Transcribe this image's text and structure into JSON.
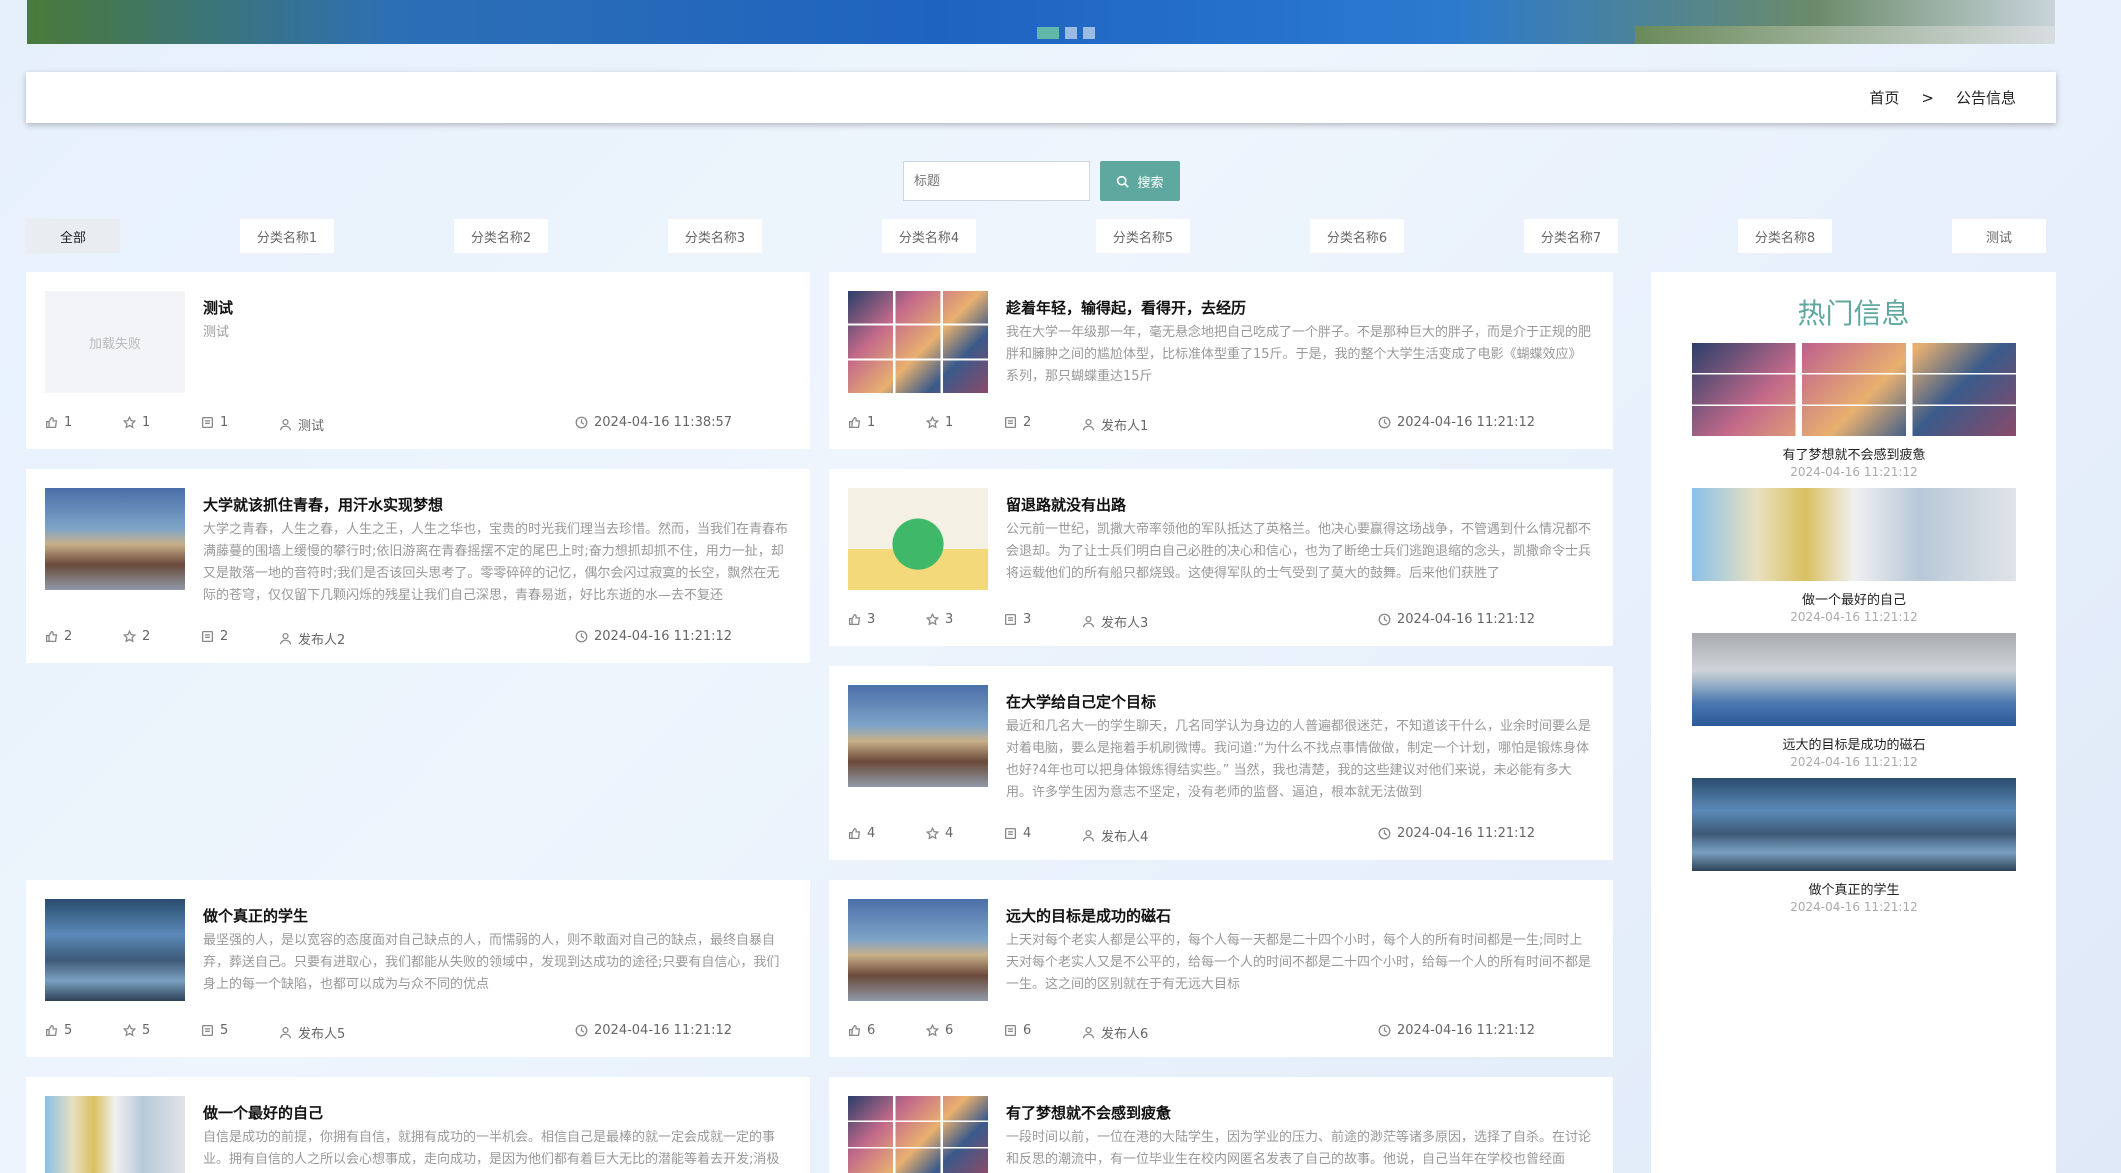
{
  "breadcrumb": {
    "home": "首页",
    "separator": ">",
    "current": "公告信息"
  },
  "search": {
    "placeholder": "标题",
    "button_label": "搜索"
  },
  "categories": [
    "全部",
    "分类名称1",
    "分类名称2",
    "分类名称3",
    "分类名称4",
    "分类名称5",
    "分类名称6",
    "分类名称7",
    "分类名称8",
    "测试"
  ],
  "placeholder_text": "加载失败",
  "articles": [
    {
      "title": "测试",
      "desc": "测试",
      "likes": "1",
      "favorites": "1",
      "comments": "1",
      "author": "测试",
      "time": "2024-04-16 11:38:57"
    },
    {
      "title": "趁着年轻，输得起，看得开，去经历",
      "desc": "我在大学一年级那一年，毫无悬念地把自己吃成了一个胖子。不是那种巨大的胖子，而是介于正规的肥胖和臃肿之间的尴尬体型，比标准体型重了15斤。于是，我的整个大学生活变成了电影《蝴蝶效应》系列，那只蝴蝶重达15斤",
      "likes": "1",
      "favorites": "1",
      "comments": "2",
      "author": "发布人1",
      "time": "2024-04-16 11:21:12"
    },
    {
      "title": "大学就该抓住青春，用汗水实现梦想",
      "desc": "大学之青春，人生之春，人生之王，人生之华也，宝贵的时光我们理当去珍惜。然而，当我们在青春布满藤蔓的围墙上缓慢的攀行时;依旧游离在青春摇摆不定的尾巴上时;奋力想抓却抓不住，用力一扯，却又是散落一地的音符时;我们是否该回头思考了。零零碎碎的记忆，偶尔会闪过寂寞的长空，飘然在无际的苍穹，仅仅留下几颗闪烁的残星让我们自己深思，青春易逝，好比东逝的水—去不复还",
      "likes": "2",
      "favorites": "2",
      "comments": "2",
      "author": "发布人2",
      "time": "2024-04-16 11:21:12"
    },
    {
      "title": "留退路就没有出路",
      "desc": "公元前一世纪，凯撒大帝率领他的军队抵达了英格兰。他决心要赢得这场战争，不管遇到什么情况都不会退却。为了让士兵们明白自己必胜的决心和信心，也为了断绝士兵们逃跑退缩的念头，凯撒命令士兵将运载他们的所有船只都烧毁。这使得军队的士气受到了莫大的鼓舞。后来他们获胜了",
      "likes": "3",
      "favorites": "3",
      "comments": "3",
      "author": "发布人3",
      "time": "2024-04-16 11:21:12"
    },
    {
      "title": "在大学给自己定个目标",
      "desc": "最近和几名大一的学生聊天，几名同学认为身边的人普遍都很迷茫，不知道该干什么，业余时间要么是对着电脑，要么是拖着手机刷微博。我问道:“为什么不找点事情做做，制定一个计划，哪怕是锻炼身体也好?4年也可以把身体锻炼得结实些。” 当然，我也清楚，我的这些建议对他们来说，未必能有多大用。许多学生因为意志不坚定，没有老师的监督、逼迫，根本就无法做到",
      "likes": "4",
      "favorites": "4",
      "comments": "4",
      "author": "发布人4",
      "time": "2024-04-16 11:21:12"
    },
    {
      "title": "做个真正的学生",
      "desc": "最坚强的人，是以宽容的态度面对自己缺点的人，而懦弱的人，则不敢面对自己的缺点，最终自暴自弃，葬送自己。只要有进取心，我们都能从失败的领域中，发现到达成功的途径;只要有自信心，我们身上的每一个缺陷，也都可以成为与众不同的优点",
      "likes": "5",
      "favorites": "5",
      "comments": "5",
      "author": "发布人5",
      "time": "2024-04-16 11:21:12"
    },
    {
      "title": "远大的目标是成功的磁石",
      "desc": "上天对每个老实人都是公平的，每个人每一天都是二十四个小时，每个人的所有时间都是一生;同时上天对每个老实人又是不公平的，给每一个人的时间不都是二十四个小时，给每一个人的所有时间不都是一生。这之间的区别就在于有无远大目标",
      "likes": "6",
      "favorites": "6",
      "comments": "6",
      "author": "发布人6",
      "time": "2024-04-16 11:21:12"
    },
    {
      "title": "做一个最好的自己",
      "desc": "自信是成功的前提，你拥有自信，就拥有成功的一半机会。相信自己是最棒的就一定会成就一定的事业。拥有自信的人之所以会心想事成，走向成功，是因为他们都有着巨大无比的潜能等着去开发;消极",
      "likes": "",
      "favorites": "",
      "comments": "",
      "author": "",
      "time": ""
    },
    {
      "title": "有了梦想就不会感到疲惫",
      "desc": "一段时间以前，一位在港的大陆学生，因为学业的压力、前途的渺茫等诸多原因，选择了自杀。在讨论和反思的潮流中，有一位毕业生在校内网匿名发表了自己的故事。他说，自己当年在学校也曾经面",
      "likes": "",
      "favorites": "",
      "comments": "",
      "author": "",
      "time": ""
    }
  ],
  "hot": {
    "title": "热门信息",
    "items": [
      {
        "name": "有了梦想就不会感到疲惫",
        "date": "2024-04-16 11:21:12"
      },
      {
        "name": "做一个最好的自己",
        "date": "2024-04-16 11:21:12"
      },
      {
        "name": "远大的目标是成功的磁石",
        "date": "2024-04-16 11:21:12"
      },
      {
        "name": "做个真正的学生",
        "date": "2024-04-16 11:21:12"
      }
    ]
  }
}
